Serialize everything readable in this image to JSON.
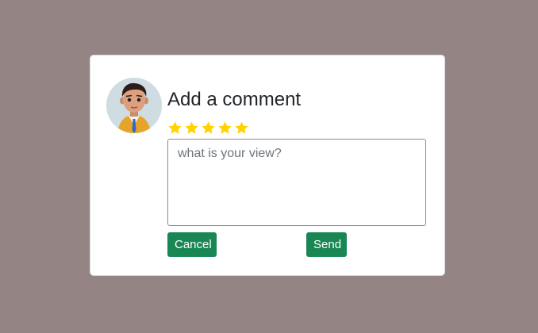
{
  "dialog": {
    "title": "Add a comment",
    "rating": {
      "value": 5,
      "max": 5,
      "color": "#ffd200"
    },
    "comment": {
      "value": "",
      "placeholder": "what is your view?"
    },
    "cancel_label": "Cancel",
    "send_label": "Send",
    "button_color": "#198754",
    "avatar_icon": "user-avatar-icon"
  },
  "colors": {
    "background": "#948483",
    "card": "#ffffff"
  }
}
